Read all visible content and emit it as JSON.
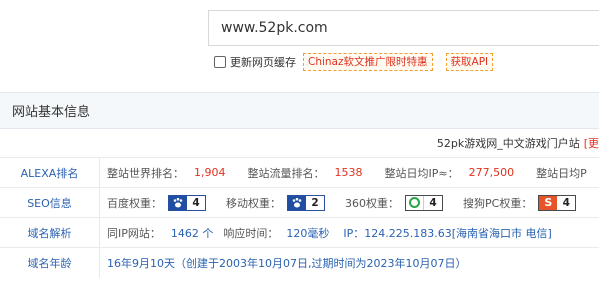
{
  "search": {
    "value": "www.52pk.com"
  },
  "options": {
    "refresh_label": "更新网页缓存",
    "promo_label": "Chinaz软文推广限时特惠",
    "api_label": "获取API"
  },
  "panel": {
    "title": "网站基本信息",
    "site_desc": "52pk游戏网_中文游戏门户站",
    "site_desc_more": "[更",
    "rows": {
      "alexa": {
        "label": "ALEXA排名",
        "world_rank_label": "整站世界排名：",
        "world_rank": "1,904",
        "traffic_rank_label": "整站流量排名：",
        "traffic_rank": "1538",
        "daily_ip_label": "整站日均IP≈：",
        "daily_ip": "277,500",
        "daily_pv_label": "整站日均P"
      },
      "seo": {
        "label": "SEO信息",
        "baidu_label": "百度权重：",
        "baidu_value": "4",
        "mobile_label": "移动权重：",
        "mobile_value": "2",
        "s360_label": "360权重：",
        "s360_value": "4",
        "sogou_label": "搜狗PC权重：",
        "sogou_value": "4",
        "sogou_icon_text": "S"
      },
      "dns": {
        "label": "域名解析",
        "same_ip_label": "同IP网站：",
        "same_ip_value": "1462 个",
        "resp_label": "响应时间：",
        "resp_value": "120毫秒",
        "ip_text": "IP：124.225.183.63[海南省海口市 电信]"
      },
      "age": {
        "label": "域名年龄",
        "text": "16年9月10天（创建于2003年10月07日,过期时间为2023年10月07日）"
      }
    }
  },
  "colors": {
    "accent_blue": "#2b62b1",
    "accent_red": "#e0321e",
    "header_bg": "#f4f8fb"
  },
  "icons": {
    "baidu": "paw-icon",
    "mobile": "paw-icon",
    "s360": "360-ring-icon",
    "sogou": "sogou-s-icon"
  }
}
